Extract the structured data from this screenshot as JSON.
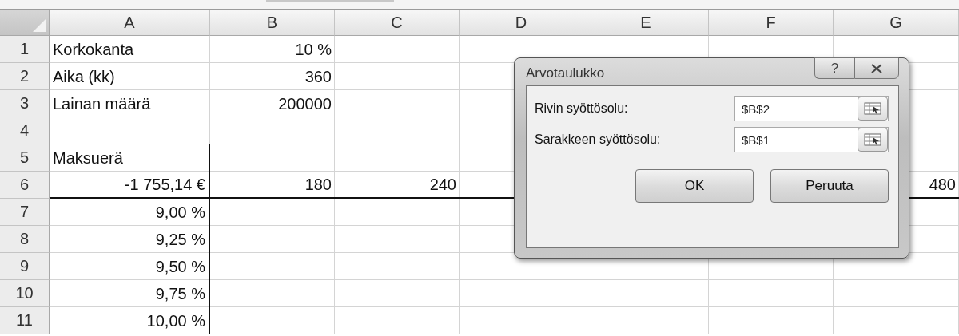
{
  "columns": [
    "A",
    "B",
    "C",
    "D",
    "E",
    "F",
    "G"
  ],
  "rows": [
    {
      "number": "1",
      "rule_below": false,
      "split_after_first": false,
      "cells": [
        {
          "text": "Korkokanta",
          "kind": "label"
        },
        {
          "text": "10 %",
          "kind": "number"
        },
        null,
        null,
        null,
        null,
        null
      ]
    },
    {
      "number": "2",
      "rule_below": false,
      "split_after_first": false,
      "cells": [
        {
          "text": "Aika (kk)",
          "kind": "label"
        },
        {
          "text": "360",
          "kind": "number"
        },
        null,
        null,
        null,
        null,
        null
      ]
    },
    {
      "number": "3",
      "rule_below": false,
      "split_after_first": false,
      "cells": [
        {
          "text": "Lainan määrä",
          "kind": "label"
        },
        {
          "text": "200000",
          "kind": "number"
        },
        null,
        null,
        null,
        null,
        null
      ]
    },
    {
      "number": "4",
      "rule_below": false,
      "split_after_first": false,
      "cells": [
        null,
        null,
        null,
        null,
        null,
        null,
        null
      ]
    },
    {
      "number": "5",
      "rule_below": false,
      "split_after_first": true,
      "cells": [
        {
          "text": "Maksuerä",
          "kind": "label"
        },
        null,
        null,
        null,
        null,
        null,
        null
      ]
    },
    {
      "number": "6",
      "rule_below": true,
      "split_after_first": true,
      "cells": [
        {
          "text": "-1 755,14 €",
          "kind": "number"
        },
        {
          "text": "180",
          "kind": "number"
        },
        {
          "text": "240",
          "kind": "number"
        },
        null,
        null,
        null,
        {
          "text": "480",
          "kind": "number"
        }
      ]
    },
    {
      "number": "7",
      "rule_below": false,
      "split_after_first": true,
      "cells": [
        {
          "text": "9,00 %",
          "kind": "number"
        },
        null,
        null,
        null,
        null,
        null,
        null
      ]
    },
    {
      "number": "8",
      "rule_below": false,
      "split_after_first": true,
      "cells": [
        {
          "text": "9,25 %",
          "kind": "number"
        },
        null,
        null,
        null,
        null,
        null,
        null
      ]
    },
    {
      "number": "9",
      "rule_below": false,
      "split_after_first": true,
      "cells": [
        {
          "text": "9,50 %",
          "kind": "number"
        },
        null,
        null,
        null,
        null,
        null,
        null
      ]
    },
    {
      "number": "10",
      "rule_below": false,
      "split_after_first": true,
      "cells": [
        {
          "text": "9,75 %",
          "kind": "number"
        },
        null,
        null,
        null,
        null,
        null,
        null
      ]
    },
    {
      "number": "11",
      "rule_below": false,
      "split_after_first": true,
      "cells": [
        {
          "text": "10,00 %",
          "kind": "number"
        },
        null,
        null,
        null,
        null,
        null,
        null
      ]
    }
  ],
  "dialog": {
    "title": "Arvotaulukko",
    "help_button": "?",
    "fields": [
      {
        "label": "Rivin syöttösolu:",
        "value": "$B$2"
      },
      {
        "label": "Sarakkeen syöttösolu:",
        "value": "$B$1"
      }
    ],
    "buttons": [
      "OK",
      "Peruuta"
    ]
  }
}
